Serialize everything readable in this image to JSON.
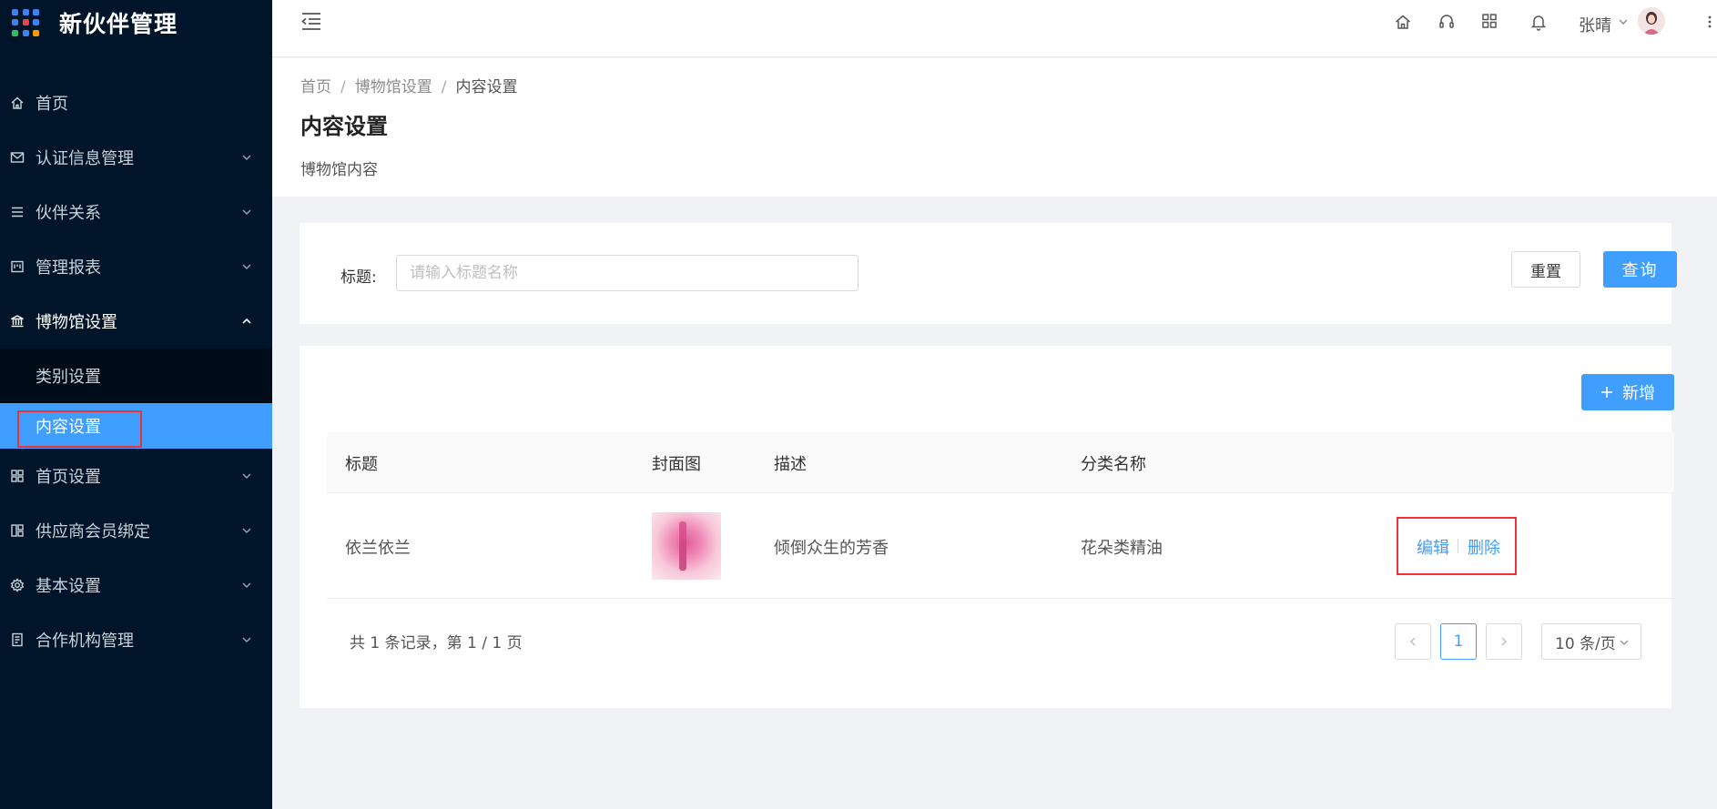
{
  "app": {
    "title": "新伙伴管理"
  },
  "sidebar": {
    "items": [
      {
        "label": "首页",
        "icon": "home-icon"
      },
      {
        "label": "认证信息管理",
        "icon": "mail-icon"
      },
      {
        "label": "伙伴关系",
        "icon": "list-icon"
      },
      {
        "label": "管理报表",
        "icon": "report-icon"
      },
      {
        "label": "博物馆设置",
        "icon": "bank-icon"
      },
      {
        "label": "首页设置",
        "icon": "layout-icon"
      },
      {
        "label": "供应商会员绑定",
        "icon": "qrcode-icon"
      },
      {
        "label": "基本设置",
        "icon": "gear-icon"
      },
      {
        "label": "合作机构管理",
        "icon": "doc-icon"
      }
    ],
    "museum_sub": [
      {
        "label": "类别设置"
      },
      {
        "label": "内容设置"
      }
    ]
  },
  "header": {
    "icons": [
      "home-icon",
      "headset-icon",
      "grid-icon",
      "bell-icon"
    ],
    "user_name": "张晴"
  },
  "breadcrumb": {
    "home": "首页",
    "parent": "博物馆设置",
    "current": "内容设置"
  },
  "page": {
    "title": "内容设置",
    "description": "博物馆内容"
  },
  "search": {
    "label": "标题:",
    "placeholder": "请输入标题名称",
    "value": "",
    "reset_label": "重置",
    "query_label": "查询"
  },
  "table": {
    "add_label": "新增",
    "columns": [
      "标题",
      "封面图",
      "描述",
      "分类名称"
    ],
    "rows": [
      {
        "title": "依兰依兰",
        "description": "倾倒众生的芳香",
        "category": "花朵类精油",
        "edit": "编辑",
        "delete": "删除"
      }
    ]
  },
  "pagination": {
    "summary": "共 1 条记录，第 1 / 1 页",
    "current_page": "1",
    "page_size": "10 条/页"
  },
  "colors": {
    "sidebar_bg": "#001529",
    "accent": "#409eff",
    "highlight_box": "#e8323c"
  }
}
